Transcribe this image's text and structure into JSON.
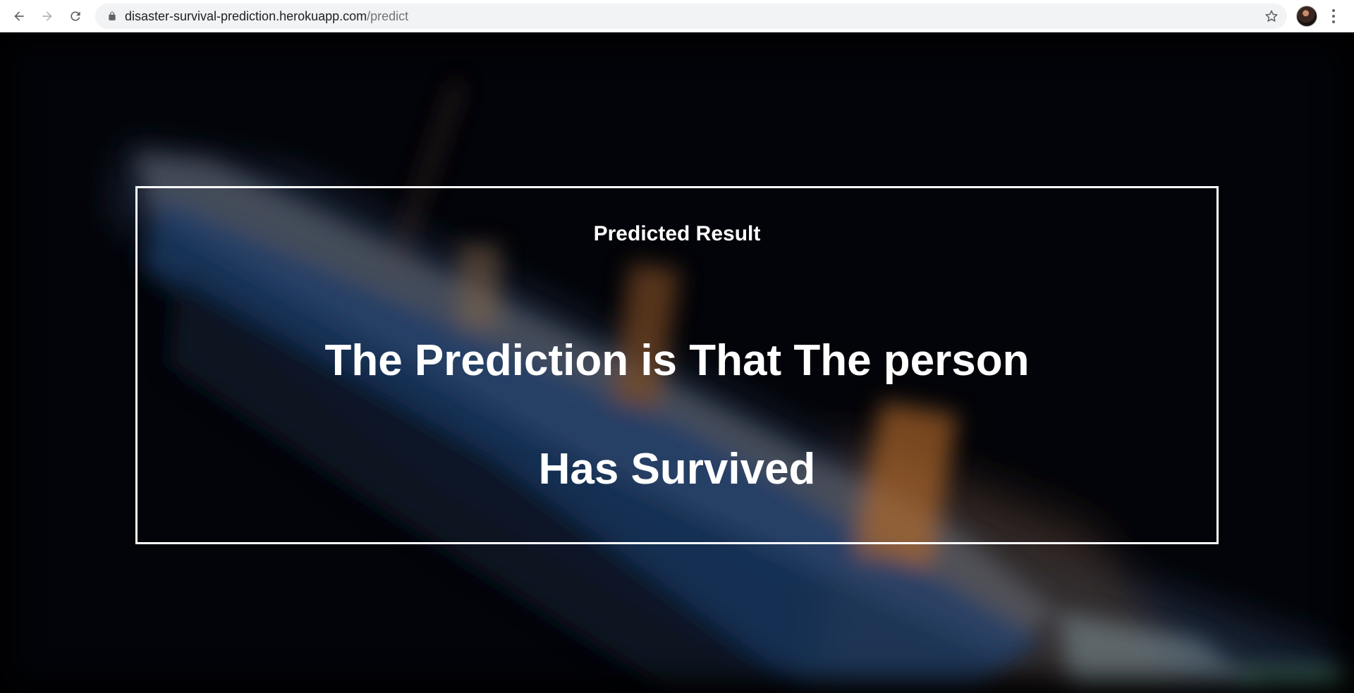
{
  "browser": {
    "url_host": "disaster-survival-prediction.herokuapp.com",
    "url_path": "/predict",
    "icons": {
      "back": "back-arrow-icon",
      "forward": "forward-arrow-icon",
      "reload": "reload-icon",
      "lock": "lock-icon",
      "bookmark": "star-icon",
      "menu": "kebab-menu-icon"
    }
  },
  "page": {
    "heading": "Predicted Result",
    "result_line_1": "The Prediction is That The person",
    "result_line_2": "Has Survived",
    "colors": {
      "text": "#ffffff",
      "border": "#ffffff",
      "background": "#000000"
    }
  }
}
